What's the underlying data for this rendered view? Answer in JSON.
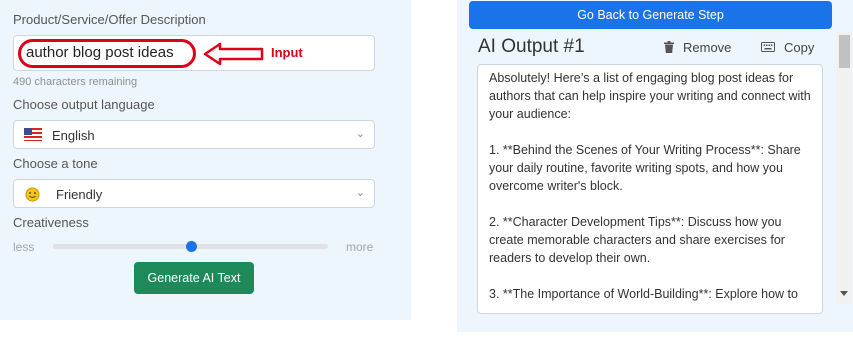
{
  "form": {
    "description_label": "Product/Service/Offer Description",
    "description_value": "author blog post ideas",
    "remaining": "490 characters remaining",
    "language_label": "Choose output language",
    "language_value": "English",
    "tone_label": "Choose a tone",
    "tone_value": "Friendly",
    "creativity_label": "Creativeness",
    "creativity_min": "less",
    "creativity_max": "more",
    "creativity_level": 0.5,
    "generate_label": "Generate AI Text"
  },
  "annotation": {
    "text": "Input",
    "color": "#e0001b"
  },
  "output": {
    "back_label": "Go Back to Generate Step",
    "title": "AI Output #1",
    "remove_label": "Remove",
    "copy_label": "Copy",
    "content": "Absolutely! Here’s a list of engaging blog post ideas for authors that can help inspire your writing and connect with your audience:\n\n1. **Behind the Scenes of Your Writing Process**: Share your daily routine, favorite writing spots, and how you overcome writer's block.\n\n2. **Character Development Tips**: Discuss how you create memorable characters and share exercises for readers to develop their own.\n\n3. **The Importance of World-Building**: Explore how to"
  },
  "colors": {
    "accent_blue": "#1a73e8",
    "generate_green": "#1e8a5a",
    "panel_bg": "#eef6fd"
  },
  "icons": {
    "language": "us-flag-icon",
    "tone": "smiley-icon",
    "remove": "trash-icon",
    "copy": "keyboard-icon"
  }
}
